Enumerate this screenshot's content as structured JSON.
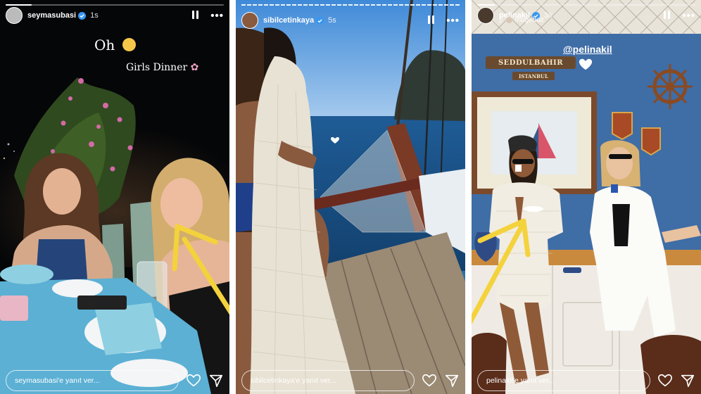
{
  "stories": [
    {
      "username": "seymasubasi",
      "time": "1s",
      "texts": {
        "oh": "Oh",
        "girls_dinner": "Girls Dinner"
      },
      "reply_placeholder": "seymasubasi'e yanıt ver..."
    },
    {
      "username": "sibilcetinkaya",
      "time": "5s",
      "reply_placeholder": "sibilcetinkaya'e yanıt ver..."
    },
    {
      "username": "pelinakil",
      "time": "3s",
      "collaborator": "mugeboz",
      "mention": "@pelinakil",
      "sign_text": "SEDDULBAHIR",
      "sign_sub": "ISTANBUL",
      "reply_placeholder": "pelinakil'e yanıt ver..."
    }
  ],
  "colors": {
    "arrow": "#f4d23c",
    "verified": "#3897f0"
  },
  "icons": [
    "verified-icon",
    "pause-icon",
    "more-icon",
    "heart-icon",
    "send-icon"
  ]
}
